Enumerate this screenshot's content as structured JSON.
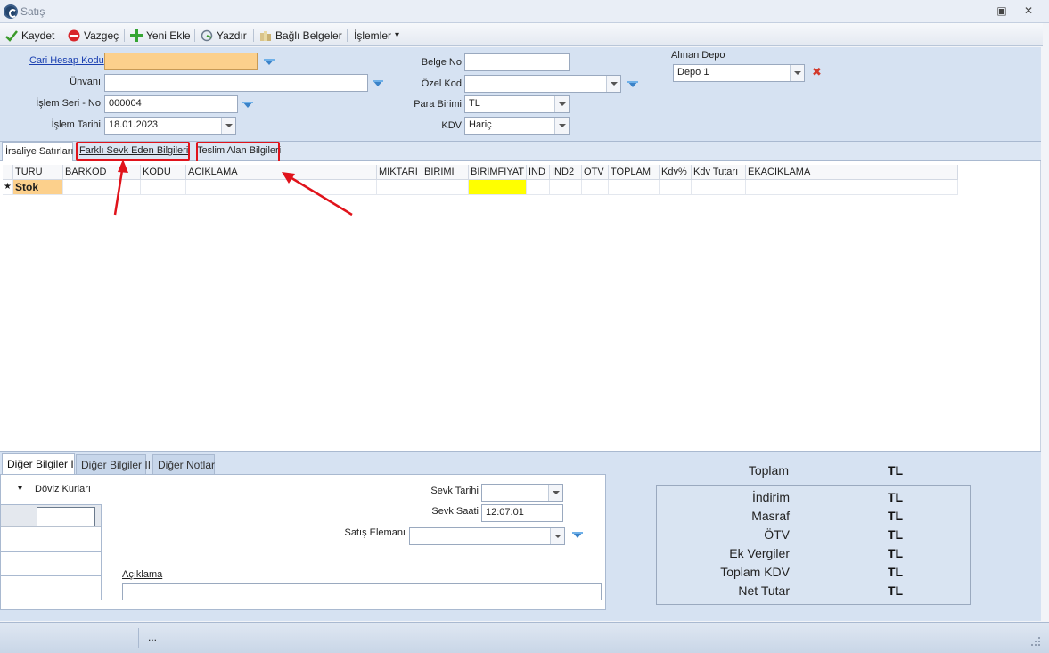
{
  "window": {
    "title": "Satış",
    "restore_glyph": "▣",
    "close_glyph": "✕"
  },
  "toolbar": {
    "save": "Kaydet",
    "cancel": "Vazgeç",
    "add_new": "Yeni Ekle",
    "print": "Yazdır",
    "linked_docs": "Bağlı Belgeler",
    "operations": "İşlemler",
    "operations_caret": "▾"
  },
  "header": {
    "account_code_label": "Cari Hesap Kodu",
    "account_code_value": "",
    "title_label": "Ünvanı",
    "title_value": "",
    "series_label": "İşlem  Seri - No",
    "series_value": "000004",
    "date_label": "İşlem Tarihi",
    "date_value": "18.01.2023",
    "doc_no_label": "Belge No",
    "doc_no_value": "",
    "special_code_label": "Özel Kod",
    "special_code_value": "",
    "currency_label": "Para Birimi",
    "currency_value": "TL",
    "vat_label": "KDV",
    "vat_value": "Hariç",
    "depot_label": "Alınan Depo",
    "depot_value": "Depo 1",
    "clear_glyph": "✖"
  },
  "tabs": {
    "t1": "İrsaliye Satırları",
    "t2": "Farklı Sevk Eden Bilgileri",
    "t3": "Teslim Alan Bilgileri"
  },
  "grid": {
    "columns": {
      "turu": "TURU",
      "barkod": "BARKOD",
      "kodu": "KODU",
      "aciklama": "ACIKLAMA",
      "miktari": "MIKTARI",
      "birimi": "BIRIMI",
      "birimfiyat": "BIRIMFIYAT",
      "ind": "IND",
      "ind2": "IND2",
      "otv": "OTV",
      "toplam": "TOPLAM",
      "kdv_pct": "Kdv%",
      "kdv_tutari": "Kdv Tutarı",
      "ekaciklama": "EKACIKLAMA"
    },
    "new_row_marker": "★",
    "row_type": "Stok"
  },
  "bottom": {
    "tabs": {
      "b1": "Diğer Bilgiler I",
      "b2": "Diğer Bilgiler II",
      "b3": "Diğer Notlar"
    },
    "fx_label": "Döviz Kurları",
    "fx_caret": "▾",
    "ship_date_label": "Sevk Tarihi",
    "ship_date_value": "",
    "ship_time_label": "Sevk Saati",
    "ship_time_value": "12:07:01",
    "salesperson_label": "Satış Elemanı",
    "salesperson_value": "",
    "note_label": "Açıklama",
    "note_value": ""
  },
  "totals": {
    "total_label": "Toplam",
    "total_cur": "TL",
    "discount_label": "İndirim",
    "discount_cur": "TL",
    "expense_label": "Masraf",
    "expense_cur": "TL",
    "otv_label": "ÖTV",
    "otv_cur": "TL",
    "extra_tax_label": "Ek Vergiler",
    "extra_tax_cur": "TL",
    "total_kdv_label": "Toplam KDV",
    "total_kdv_cur": "TL",
    "net_label": "Net Tutar",
    "net_cur": "TL"
  },
  "statusbar": {
    "ellipsis": "..."
  },
  "colors": {
    "accent_red": "#e0131b",
    "highlight_yellow": "#ffff00",
    "highlight_orange": "#fcd08c"
  }
}
